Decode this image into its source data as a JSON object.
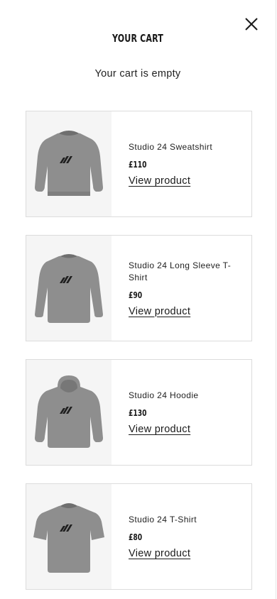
{
  "cart": {
    "title": "YOUR CART",
    "empty_message": "Your cart is empty",
    "close_icon": "close-icon"
  },
  "products": [
    {
      "name": "Studio 24 Sweatshirt",
      "price": "£110",
      "link_label": "View product",
      "image": "sweatshirt-image"
    },
    {
      "name": "Studio 24 Long Sleeve T-Shirt",
      "price": "£90",
      "link_label": "View product",
      "image": "long-sleeve-tshirt-image"
    },
    {
      "name": "Studio 24 Hoodie",
      "price": "£130",
      "link_label": "View product",
      "image": "hoodie-image"
    },
    {
      "name": "Studio 24 T-Shirt",
      "price": "£80",
      "link_label": "View product",
      "image": "tshirt-image"
    }
  ],
  "colors": {
    "garment": "#8e8e8e",
    "thumb_bg": "#f5f5f5",
    "border": "#dcdcdc",
    "text": "#1a1a1a"
  }
}
